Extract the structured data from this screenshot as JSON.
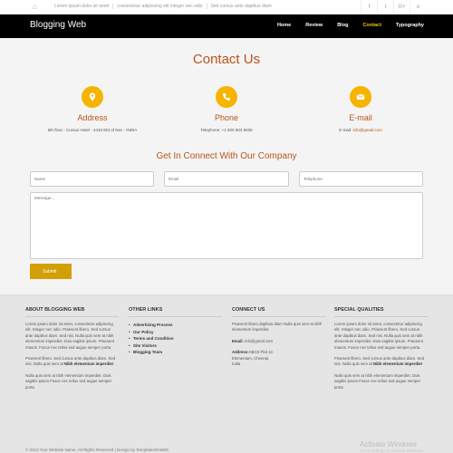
{
  "topbar": {
    "links": [
      "Lorem ipsum dolor sit amet",
      "consectetur adipiscing elit integer nec odio",
      "Sed cursus ante dapibus diam"
    ],
    "social": [
      "f",
      "t",
      "G+",
      "o"
    ]
  },
  "nav": {
    "brand": "Blogging Web",
    "menu": [
      "Home",
      "Review",
      "Blog",
      "Contact",
      "Typography"
    ],
    "active": "Contact"
  },
  "contact": {
    "title": "Contact Us",
    "address": {
      "heading": "Address",
      "text": "6th floor - Cursus Hotel - 2410 Ebt of Nec - INDIA"
    },
    "phone": {
      "heading": "Phone",
      "text": "Telephone: +1 600 503 8035"
    },
    "email": {
      "heading": "E-mail",
      "label": "E-mail: ",
      "link": "info@gmail.com"
    }
  },
  "form": {
    "heading": "Get In Connect With Our Company",
    "name_placeholder": "Name",
    "email_placeholder": "Email",
    "phone_placeholder": "Telephone",
    "message_placeholder": "Message...",
    "submit_label": "Submit"
  },
  "footer": {
    "about": {
      "heading": "ABOUT BLOGGING WEB",
      "p1": "Lorem ipsum dolor sit amet, consectetur adipiscing elit. Integer nec odio. Praesent libero. Sed cursus ante dapibus diam. Sed nisi. Nulla quis sem at nibh elementum imperdiet. Duis sagittis ipsum. Praesent mauris. Fusce nec tellus sed augue semper porta.",
      "p2_text": "Praesent libero. Sed cursus ante dapibus diam. Sed nisi. Nulla quis sem at ",
      "p2_bold": "Nibh elementum imperdiet",
      "p3": "Nulla quis sem at nibh elementum imperdiet. Duis sagittis ipsum Fusce nec tellus sed augue semper porta"
    },
    "links": {
      "heading": "OTHER LINKS",
      "items": [
        "Advertising Process",
        "Our Policy",
        "Terms and Condition",
        "Site Visitors",
        "Blogging Team"
      ]
    },
    "contact": {
      "heading": "CONNECT US",
      "p1": "Praesent libero dapibus diam Nulla quis sem at nibh elementum imperdiet.",
      "email_label": "Email:",
      "email": " info@gmail.com",
      "address_label": "Address:",
      "address_lines": [
        "ABCD Flat 12.",
        "Elementum, Chennai,",
        "India"
      ]
    },
    "special": {
      "heading": "SPECIAL QUALITIES",
      "p1": "Lorem ipsum dolor sit amet, consectetur adipiscing elit. Integer nec odio. Praesent libero. Sed cursus ante dapibus diam. Sed nisi. Nulla quis sem at nibh elementum imperdiet. Duis sagittis ipsum. Praesent mauris. Fusce nec tellus sed augue semper porta.",
      "p2_text": "Praesent libero. Sed cursus ante dapibus diam. Sed nisi. Nulla quis sem at ",
      "p2_bold": "Nibh elementum imperdiet",
      "p3": "Nulla quis sem at nibh elementum imperdiet. Duis sagittis ipsum Fusce nec tellus sed augue semper porta"
    },
    "copyright": "© 2013 Your Website Name. All Rights Reserved | Design by TemplatesOnWeb"
  },
  "watermark": {
    "title": "Activate Windows",
    "subtitle": "Go to Settings to activate Windows."
  },
  "colors": {
    "accent": "#b8541a",
    "icon_bg": "#f5b400",
    "button": "#d29f06",
    "active_nav": "#f5c400"
  }
}
